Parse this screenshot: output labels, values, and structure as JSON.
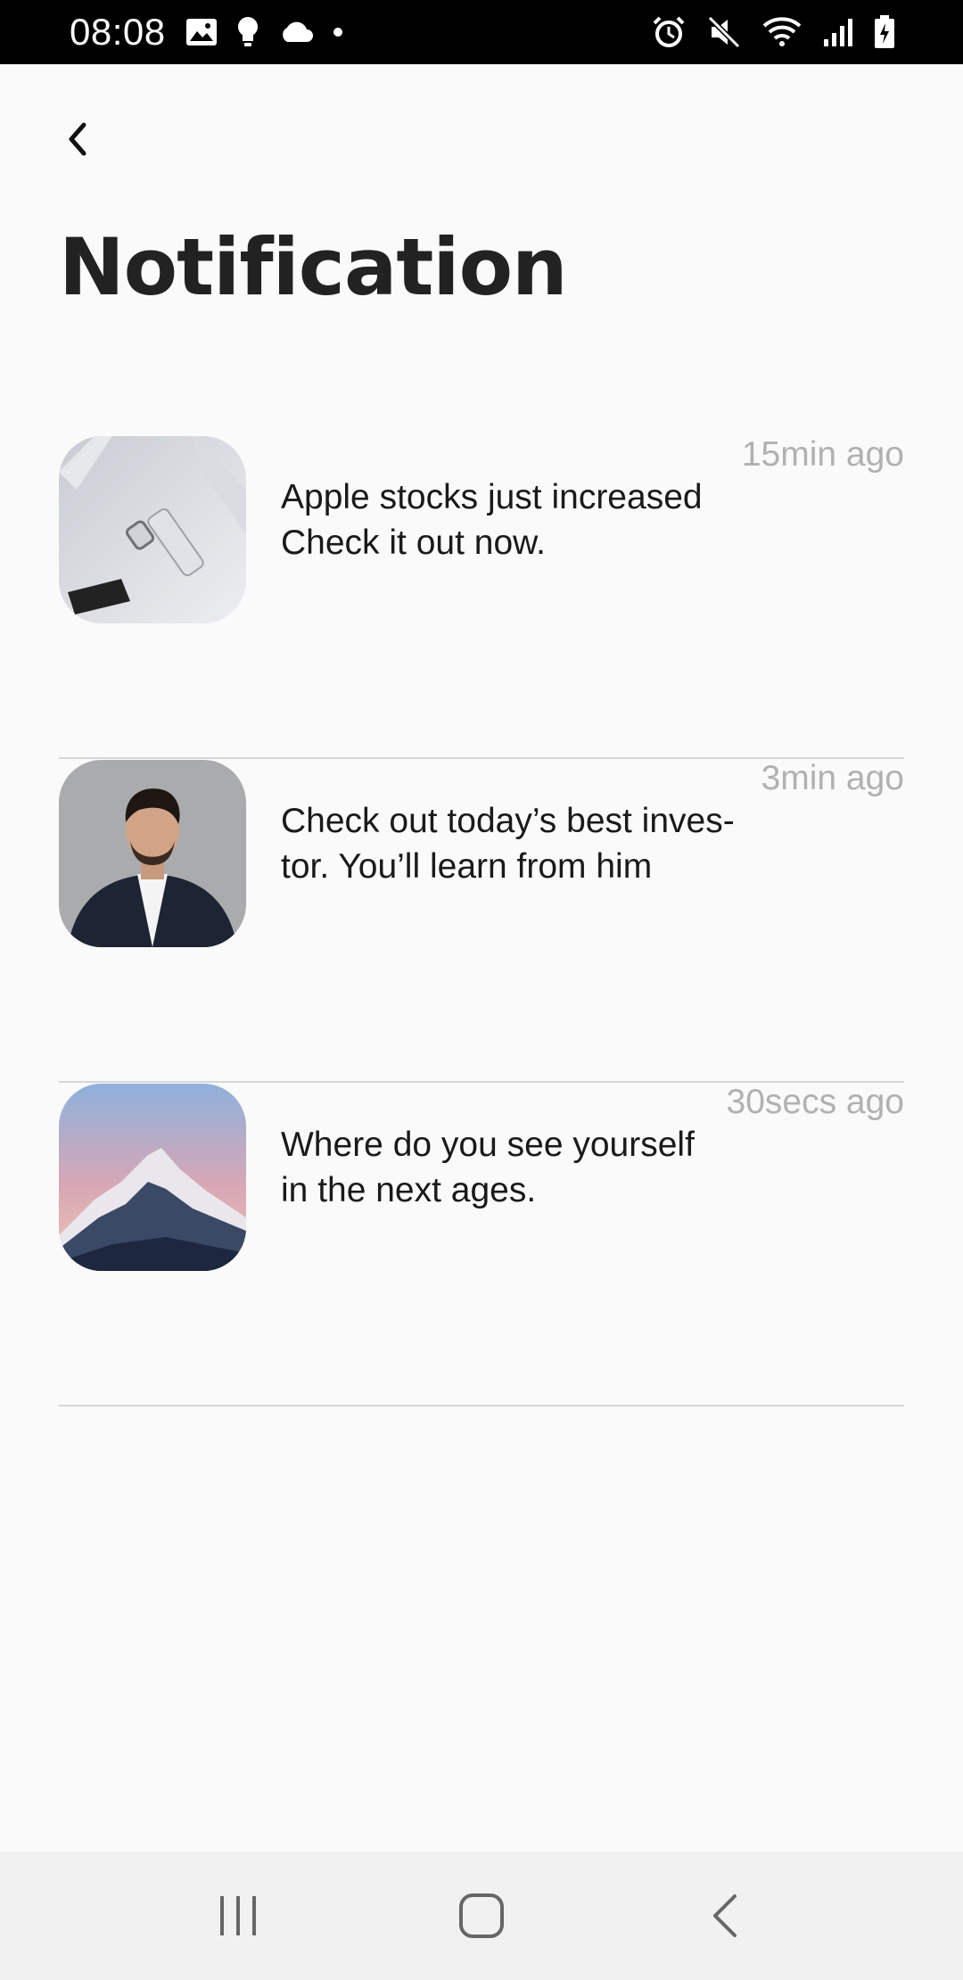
{
  "status_bar": {
    "time": "08:08",
    "left_icons": [
      "image-icon",
      "bulb-icon",
      "cloud-icon",
      "dot-icon"
    ],
    "right_icons": [
      "alarm-icon",
      "mute-icon",
      "wifi-icon",
      "signal-icon",
      "battery-icon"
    ]
  },
  "header": {
    "back_icon": "chevron-left-icon",
    "title": "Notification"
  },
  "notifications": [
    {
      "thumb": "devices-photo",
      "message": "Apple stocks just increased\nCheck it out now.",
      "time": "15min ago"
    },
    {
      "thumb": "man-portrait-photo",
      "message": "Check out today’s best inves-\ntor. You’ll learn from him",
      "time": "3min ago"
    },
    {
      "thumb": "mountain-photo",
      "message": "Where do you see yourself\nin the next ages.",
      "time": "30secs ago"
    }
  ],
  "nav_bar": {
    "items": [
      "recent-apps-icon",
      "home-icon",
      "back-icon"
    ]
  },
  "colors": {
    "background": "#fafafa",
    "title": "#222222",
    "message": "#1a1a1a",
    "timestamp": "#b1b1b1",
    "divider": "#d6d6d6",
    "status_bar": "#000000",
    "nav_bar": "#f1f1f1"
  }
}
